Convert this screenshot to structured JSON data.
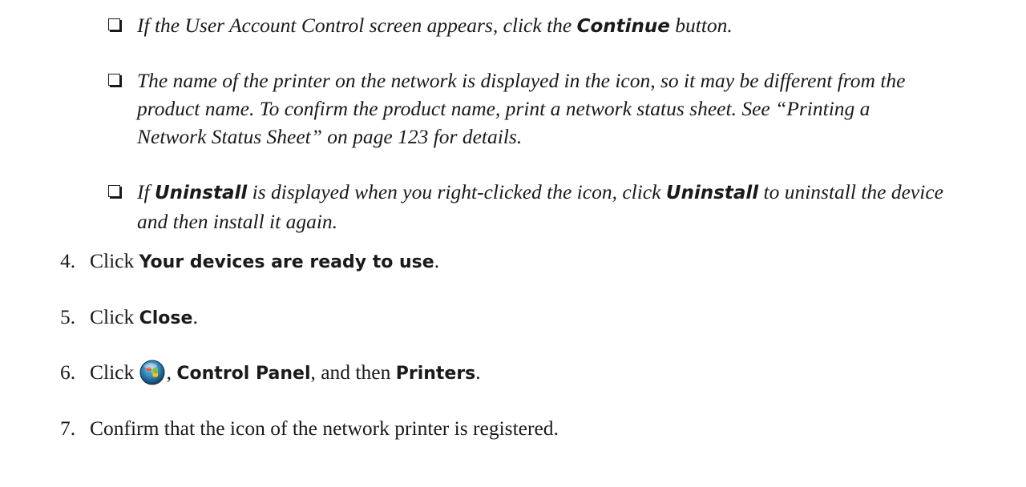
{
  "notes": [
    {
      "pre": "If the User Account Control screen appears, click the ",
      "kw1": "Continue",
      "post": " button."
    },
    {
      "line1": "The name of the printer on the network is displayed in the icon, so it may be different from the",
      "line2": "product name. To confirm the product name, print a network status sheet. See “Printing a",
      "line3": "Network Status Sheet” on page 123 for details."
    },
    {
      "pre": "If ",
      "kw1": "Uninstall",
      "mid": " is displayed when you right-clicked the icon, click ",
      "kw2": "Uninstall",
      "post": " to uninstall the device",
      "line2": "and then install it again."
    }
  ],
  "steps": {
    "s4": {
      "num": "4.",
      "pre": "Click ",
      "bold": "Your devices are ready to use",
      "post": "."
    },
    "s5": {
      "num": "5.",
      "pre": "Click ",
      "bold": "Close",
      "post": "."
    },
    "s6": {
      "num": "6.",
      "pre": "Click ",
      "icon": "windows-start-orb-icon",
      "sep": ", ",
      "bold1": "Control Panel",
      "mid": ", and then ",
      "bold2": "Printers",
      "post": "."
    },
    "s7": {
      "num": "7.",
      "text": "Confirm that the icon of the network printer is registered."
    }
  }
}
